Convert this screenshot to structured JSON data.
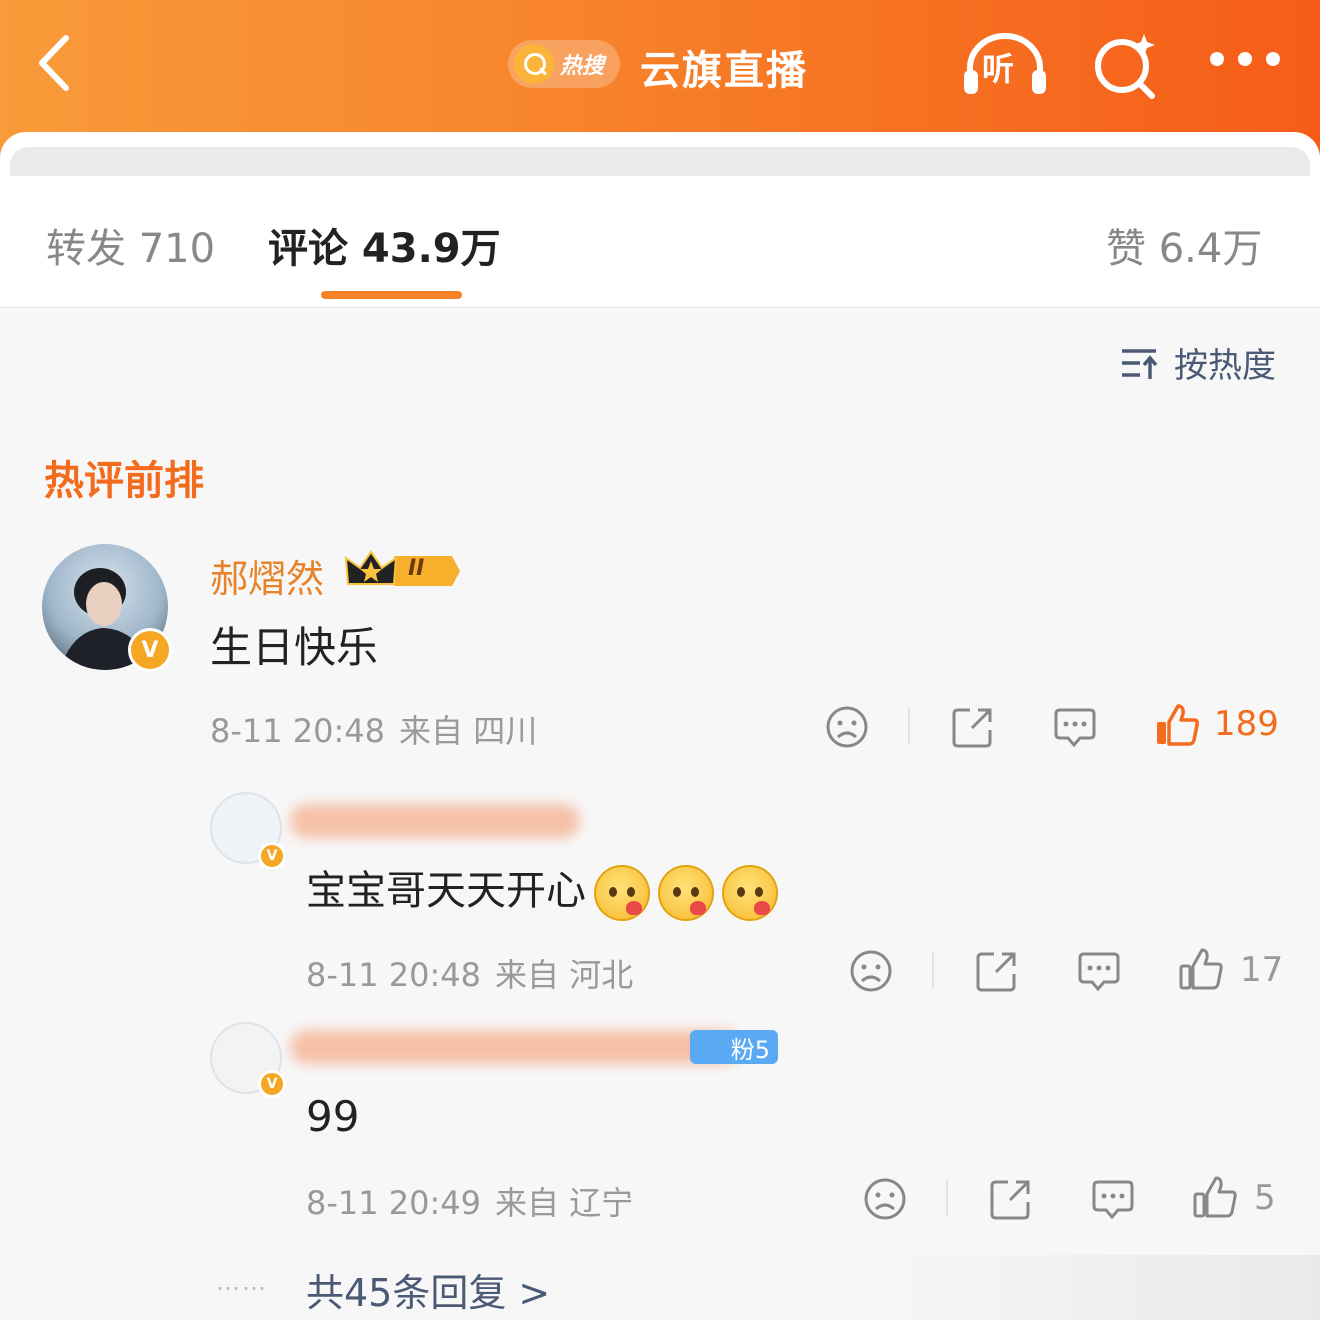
{
  "header": {
    "hot_badge": "热搜",
    "title": "云旗直播",
    "listen_label": "听"
  },
  "tabs": {
    "repost": "转发 710",
    "comments": "评论 43.9万",
    "likes": "赞 6.4万"
  },
  "sort_label": "按热度",
  "section_title": "热评前排",
  "comments": [
    {
      "user": "郝熠然",
      "rank_badge": "II",
      "text": "生日快乐",
      "time": "8-11 20:48",
      "location": "来自 四川",
      "likes": "189"
    },
    {
      "text": "宝宝哥天天开心",
      "time": "8-11 20:48",
      "location": "来自 河北",
      "likes": "17"
    },
    {
      "fan_badge": "粉5",
      "text": "99",
      "time": "8-11 20:49",
      "location": "来自 辽宁",
      "likes": "5"
    }
  ],
  "more_replies": "共45条回复 >",
  "colors": {
    "accent": "#f7822a",
    "hot_text": "#f36b1c",
    "link": "#4a5a75"
  }
}
